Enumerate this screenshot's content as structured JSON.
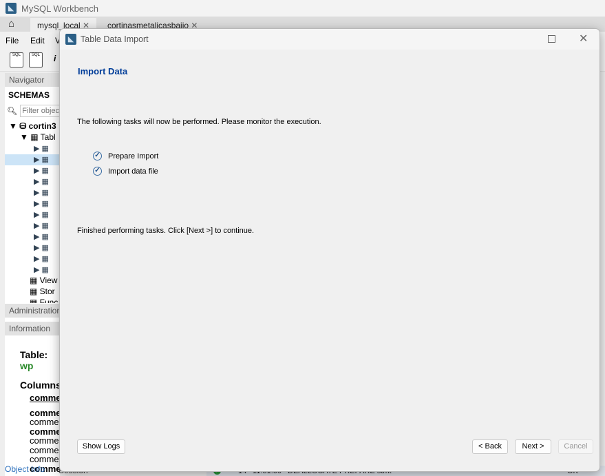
{
  "app": {
    "title": "MySQL Workbench",
    "tabs": [
      {
        "label": "mysql_local"
      },
      {
        "label": "cortinasmetalicasbaiio"
      }
    ],
    "menu": [
      "File",
      "Edit",
      "V"
    ],
    "navigator": {
      "header": "Navigator",
      "schemas_label": "SCHEMAS",
      "filter_placeholder": "Filter objects",
      "schema": "cortin3",
      "tables": "Tabl",
      "views": "View",
      "stored": "Stor",
      "functions": "Func",
      "administration": "Administration",
      "information": "Information"
    },
    "info": {
      "table_label": "Table:",
      "table_value": "wp",
      "columns_label": "Columns:",
      "rows": [
        "comme",
        "comme",
        "commer",
        "comme",
        "commer",
        "commer",
        "commer",
        "comme"
      ]
    },
    "bottom_tabs": {
      "object_info": "Object Info",
      "session": "Session"
    },
    "log": {
      "index": "14",
      "time": "11:51:00",
      "action": "DEALLOCATE PREPARE stmt",
      "status": "OK"
    }
  },
  "dialog": {
    "title": "Table Data Import",
    "heading": "Import Data",
    "intro": "The following tasks will now be performed. Please monitor the execution.",
    "tasks": [
      {
        "label": "Prepare Import",
        "done": true
      },
      {
        "label": "Import data file",
        "done": true
      }
    ],
    "status": "Finished performing tasks. Click [Next >] to continue.",
    "buttons": {
      "show_logs": "Show Logs",
      "back": "< Back",
      "next": "Next >",
      "cancel": "Cancel"
    },
    "accent": "#003d99"
  }
}
